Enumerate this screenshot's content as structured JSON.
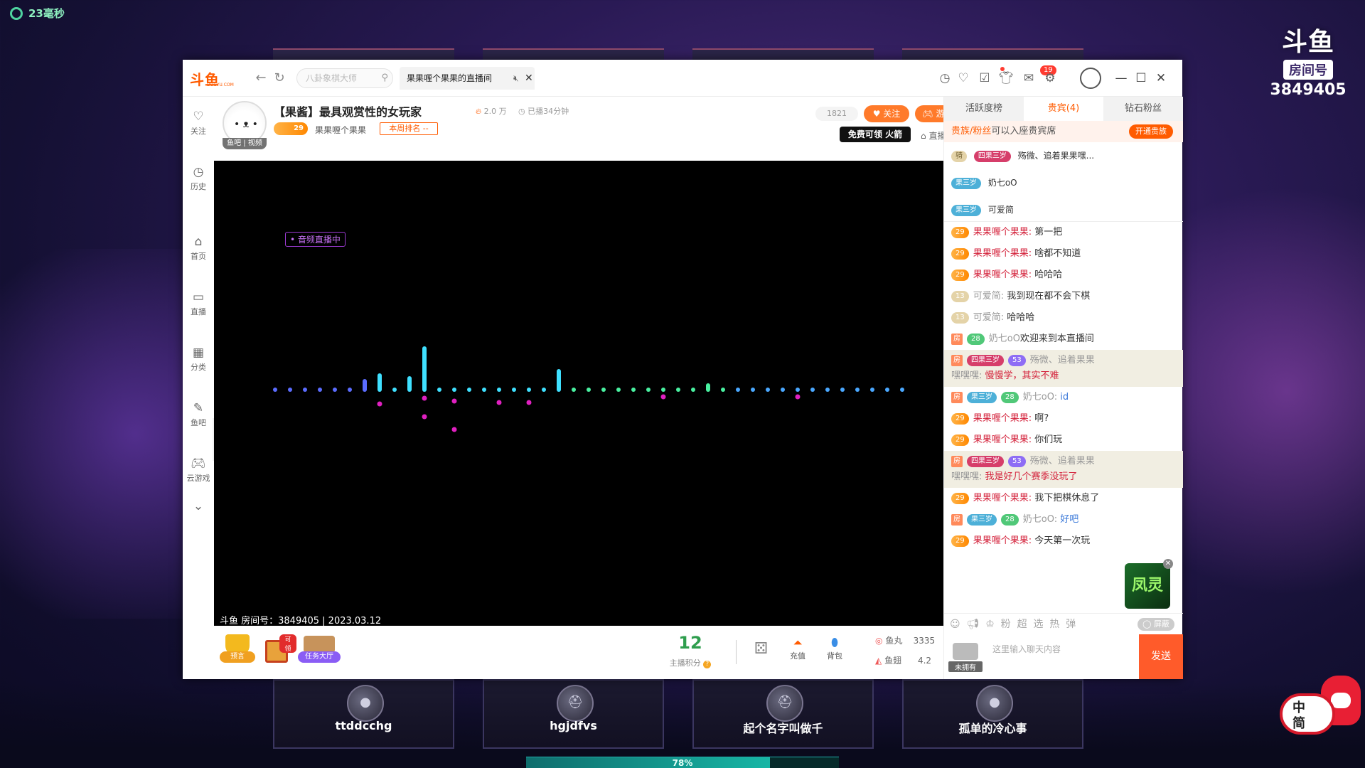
{
  "desktop": {
    "ping": "23毫秒",
    "room_badge": {
      "logo": "斗鱼",
      "tag": "房间号",
      "number": "3849405"
    },
    "players": [
      {
        "name": "ttddcchg",
        "avatar_icon": "hero-portrait"
      },
      {
        "name": "hgjdfvs",
        "avatar_icon": "helmet-icon"
      },
      {
        "name": "起个名字叫做千",
        "avatar_icon": "helmet-icon"
      },
      {
        "name": "孤单的冷心事",
        "avatar_icon": "hero-portrait"
      }
    ],
    "progress": {
      "value_percent": 78,
      "label": "78%"
    },
    "ime": {
      "label_top": "中",
      "label_bottom": "简"
    }
  },
  "titlebar": {
    "logo": "斗鱼",
    "logo_sub": "DOUYU.COM",
    "search_placeholder": "八卦象棋大师",
    "tab_title": "果果喱个果果的直播间",
    "notification_count": "19"
  },
  "leftnav": [
    {
      "label": "关注",
      "icon": "heart-icon"
    },
    {
      "label": "历史",
      "icon": "clock-icon"
    },
    {
      "label": "首页",
      "icon": "home-icon"
    },
    {
      "label": "直播",
      "icon": "tv-icon"
    },
    {
      "label": "分类",
      "icon": "grid-icon"
    },
    {
      "label": "鱼吧",
      "icon": "fishbar-icon"
    },
    {
      "label": "云游戏",
      "icon": "gamepad-icon"
    }
  ],
  "stream": {
    "avatar_tag": "鱼吧 | 视频",
    "title": "【果酱】最具观赏性的女玩家",
    "heat": "2.0 万",
    "duration": "已播34分钟",
    "level": "29",
    "anchor_name": "果果喱个果果",
    "rank": "本周排名 --",
    "fans": "1821",
    "follow": "关注",
    "bar": "游戏吧",
    "free_banner": "免费可领 火箭",
    "announce": "直播公告",
    "audio_tag": "• 音频直播中",
    "info": "斗鱼 房间号：3849405 | 2023.03.12"
  },
  "bottombar": {
    "preview": "预言",
    "gift_tag": "可领",
    "task": "任务大厅",
    "score": "12",
    "score_label": "主播积分",
    "recharge": "充值",
    "backpack": "背包",
    "fishball_label": "鱼丸",
    "fishball_value": "3335",
    "fishfin_label": "鱼翅",
    "fishfin_value": "4.2"
  },
  "rightpanel": {
    "tabs": [
      "活跃度榜",
      "贵宾(4)",
      "钻石粉丝"
    ],
    "vip_strip_hl": "贵族/粉丝",
    "vip_strip_rest": "可以入座贵宾席",
    "vip_button": "开通贵族",
    "vip_list": [
      {
        "badge": "四果三岁",
        "name": "殇微、追着果果嘿..."
      },
      {
        "badge": "果三岁",
        "name": "奶七oO"
      },
      {
        "badge": "果三岁",
        "name": "可爱简"
      }
    ],
    "chat": [
      {
        "user": "果果喱个果果:",
        "text": "第一把"
      },
      {
        "user": "果果喱个果果:",
        "text": "啥都不知道"
      },
      {
        "user": "果果喱个果果:",
        "text": "哈哈哈"
      },
      {
        "user": "可爱简:",
        "text": "我到现在都不会下棋"
      },
      {
        "user": "可爱简:",
        "text": "哈哈哈"
      },
      {
        "user": "奶七oO",
        "text": "欢迎来到本直播间"
      },
      {
        "user": "殇微、追着果果",
        "text": "嘿嘿嘿:",
        "extra": "慢慢学，其实不难"
      },
      {
        "user": "奶七oO:",
        "text": "id"
      },
      {
        "user": "果果喱个果果:",
        "text": "啊?"
      },
      {
        "user": "果果喱个果果:",
        "text": "你们玩"
      },
      {
        "user": "殇微、追着果果",
        "text": "嘿嘿嘿:",
        "extra": "我是好几个赛季没玩了"
      },
      {
        "user": "果果喱个果果:",
        "text": "我下把棋休息了"
      },
      {
        "user": "奶七oO:",
        "text": "好吧"
      },
      {
        "user": "果果喱个果果:",
        "text": "今天第一次玩"
      }
    ],
    "chat_tools": [
      "粉",
      "超",
      "选",
      "热",
      "弹"
    ],
    "shield": "屏蔽",
    "no_item": "未拥有",
    "input_placeholder": "这里输入聊天内容",
    "send": "发送",
    "ad_text": "凤灵"
  },
  "colors": {
    "accent": "#ff5b00",
    "viz_cyan": "#3fe0ff",
    "viz_green": "#49f0a0",
    "viz_magenta": "#e020c0"
  }
}
